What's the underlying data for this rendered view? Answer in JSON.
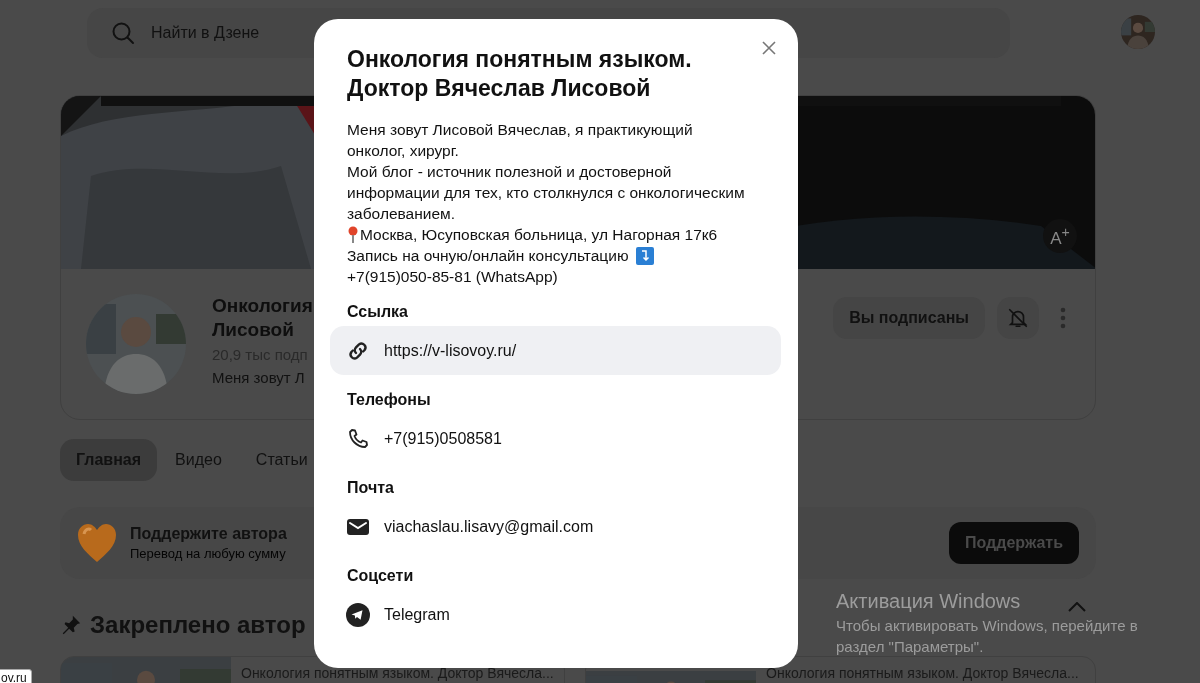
{
  "header": {
    "search": {
      "placeholder": "Найти в Дзене"
    }
  },
  "cover": {
    "font_button": "A$^{+}$"
  },
  "channel": {
    "title_lines": [
      "Онкология",
      "Лисовой"
    ],
    "subscribers": "20,9 тыс подп",
    "description": "Меня зовут Л",
    "subscribe_button": "Вы подписаны",
    "notifications_on": false
  },
  "tabs": [
    {
      "label": "Главная",
      "selected": true
    },
    {
      "label": "Видео",
      "selected": false
    },
    {
      "label": "Статьи",
      "selected": false
    }
  ],
  "support": {
    "title": "Поддержите автора",
    "subtitle": "Перевод на любую сумму",
    "button": "Поддержать"
  },
  "pinned": {
    "heading": "Закреплено автор",
    "cards": [
      {
        "title": "Онкология понятным языком. Доктор Вячесла..."
      },
      {
        "title": "Онкология понятным языком. Доктор Вячесла..."
      }
    ]
  },
  "modal": {
    "title": "Онкология понятным языком. Доктор Вячеслав Лисовой",
    "bio": [
      {
        "kind": "text",
        "text": "Меня зовут Лисовой Вячеслав, я практикующий онколог, хирург."
      },
      {
        "kind": "text",
        "text": "Мой блог - источник полезной и достоверной информации для тех, кто столкнулся с онкологическим заболеванием."
      },
      {
        "kind": "location",
        "text": "Москва, Юсуповская больница, ул Нагорная 17к6"
      },
      {
        "kind": "appointment",
        "text": "Запись на очную/онлайн консультацию"
      },
      {
        "kind": "text",
        "text": "+7(915)050-85-81 (WhatsApp)"
      }
    ],
    "sections": [
      {
        "heading": "Ссылка",
        "kind": "link",
        "value": "https://v-lisovoy.ru/",
        "highlighted": true
      },
      {
        "heading": "Телефоны",
        "kind": "phone",
        "value": "+7(915)0508581",
        "highlighted": false
      },
      {
        "heading": "Почта",
        "kind": "mail",
        "value": "viachaslau.lisavy@gmail.com",
        "highlighted": false
      },
      {
        "heading": "Соцсети",
        "kind": "telegram",
        "value": "Telegram",
        "highlighted": false
      }
    ]
  },
  "os_notice": {
    "title": "Активация Windows",
    "text": "Чтобы активировать Windows, перейдите в раздел \"Параметры\"."
  },
  "status_bar": {
    "url": "ov.ru"
  }
}
